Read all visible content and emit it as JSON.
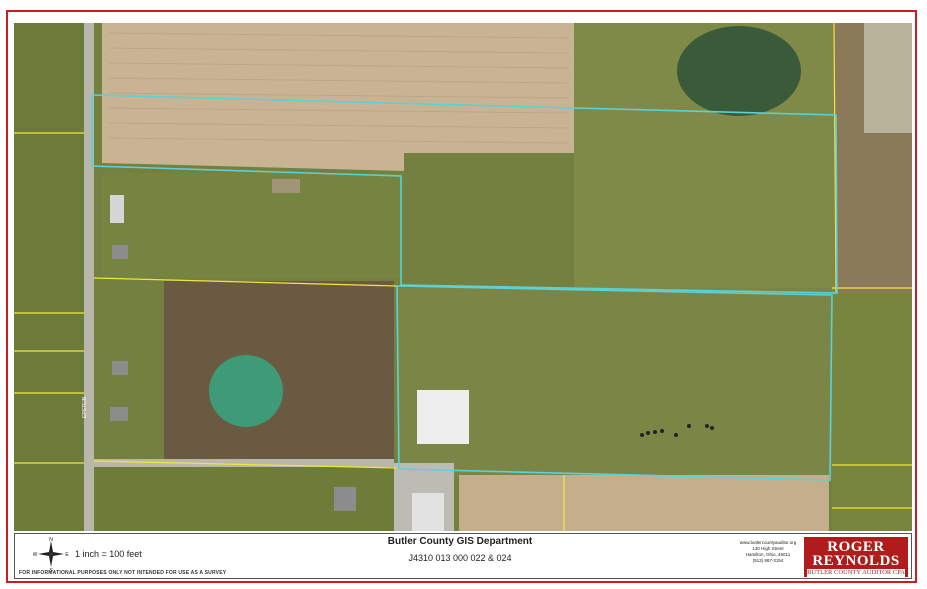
{
  "map": {
    "road_label": "EPSTEIN",
    "colors": {
      "parcel_outline": "#5ad2d8",
      "lot_lines": "#f2e63c",
      "border": "#c81e1e"
    }
  },
  "footer": {
    "scale": "1 inch = 100 feet",
    "department": "Butler County GIS Department",
    "parcel_ids": "J4310 013 000 022 & 024",
    "disclaimer": "FOR INFORMATIONAL PURPOSES ONLY NOT INTENDED FOR USE AS A SURVEY",
    "contact": {
      "url": "www.butlercountyauditor.org",
      "street": "130 High Street",
      "city": "Hamilton, Ohio, 45011",
      "phone": "(513) 887-3154"
    },
    "brand": {
      "line1": "ROGER",
      "line2": "REYNOLDS",
      "line3": "BUTLER COUNTY AUDITOR CPA"
    },
    "compass": {
      "n": "N",
      "s": "S",
      "e": "E",
      "w": "W"
    }
  }
}
